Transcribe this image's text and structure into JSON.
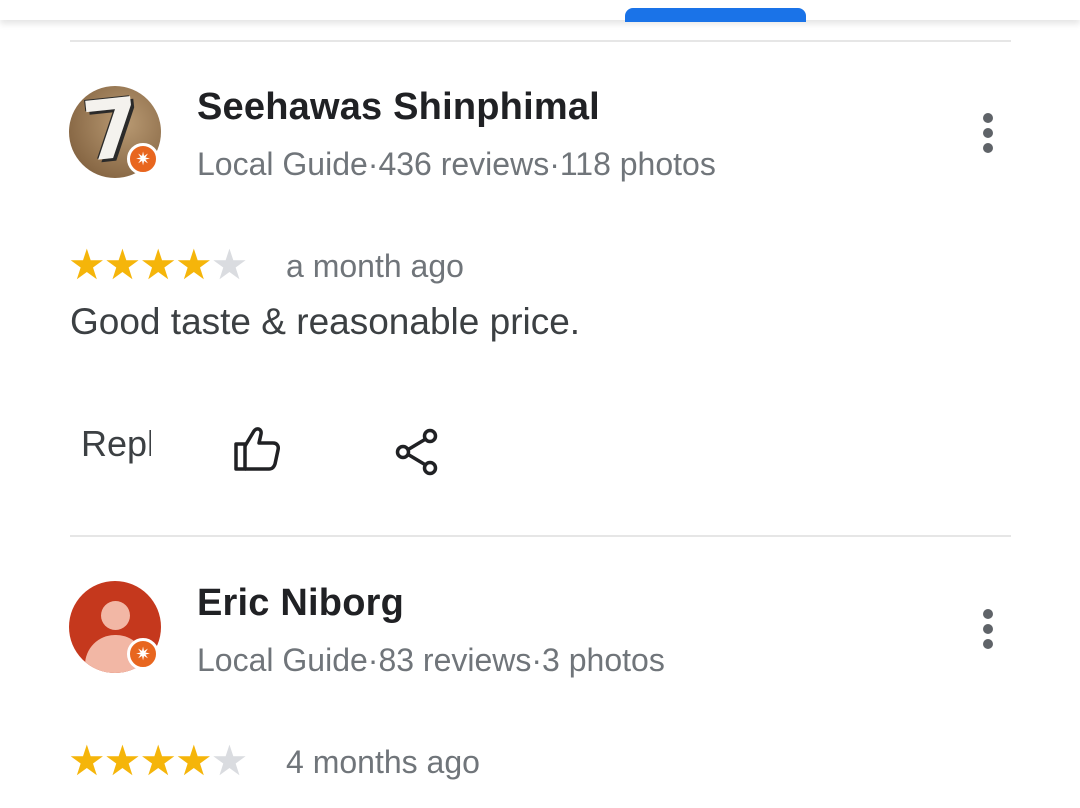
{
  "reviews": [
    {
      "name": "Seehawas Shinphimal",
      "meta": "Local Guide·436 reviews·118 photos",
      "stars_filled": 4,
      "stars_total": 5,
      "time": "a month ago",
      "text": "Good taste & reasonable price.",
      "reply_label": "Reply",
      "avatar_label": "7"
    },
    {
      "name": "Eric Niborg",
      "meta": "Local Guide·83 reviews·3 photos",
      "stars_filled": 4,
      "stars_total": 5,
      "time": "4 months ago"
    }
  ],
  "icons": {
    "more": "more-vert-icon",
    "like": "thumbs-up-icon",
    "share": "share-icon",
    "badge": "local-guide-star-icon",
    "star_filled": "★",
    "star_empty": "★"
  },
  "colors": {
    "accent": "#1a73e8",
    "star": "#f5b50a",
    "badge": "#e8661f",
    "avatar_generic": "#c5381d"
  }
}
